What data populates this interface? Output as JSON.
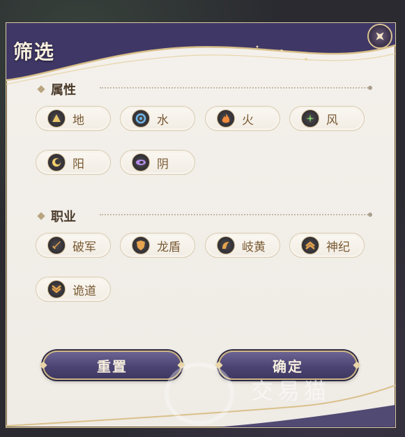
{
  "title": "筛选",
  "sections": [
    {
      "title": "属性",
      "options": [
        {
          "label": "地",
          "icon": "earth-element-icon",
          "color": "#e9c46a"
        },
        {
          "label": "水",
          "icon": "water-element-icon",
          "color": "#6fb8e8"
        },
        {
          "label": "火",
          "icon": "fire-element-icon",
          "color": "#f08a3c"
        },
        {
          "label": "风",
          "icon": "wind-element-icon",
          "color": "#7fd36b"
        },
        {
          "label": "阳",
          "icon": "sun-element-icon",
          "color": "#f5cf6a"
        },
        {
          "label": "阴",
          "icon": "moon-element-icon",
          "color": "#b48ee8"
        }
      ]
    },
    {
      "title": "职业",
      "options": [
        {
          "label": "破军",
          "icon": "sword-class-icon",
          "color": "#e6a44e"
        },
        {
          "label": "龙盾",
          "icon": "shield-class-icon",
          "color": "#e6a44e"
        },
        {
          "label": "岐黄",
          "icon": "healer-class-icon",
          "color": "#e6a44e"
        },
        {
          "label": "神纪",
          "icon": "chevron-up-class-icon",
          "color": "#e6a44e"
        },
        {
          "label": "诡道",
          "icon": "chevron-down-class-icon",
          "color": "#e6a44e"
        }
      ]
    }
  ],
  "buttons": {
    "reset": "重置",
    "confirm": "确定"
  },
  "watermark": "交易猫",
  "colors": {
    "accent_purple": "#4c4472",
    "gold_trim": "#cdb583",
    "chip_text": "#7a5a34"
  }
}
